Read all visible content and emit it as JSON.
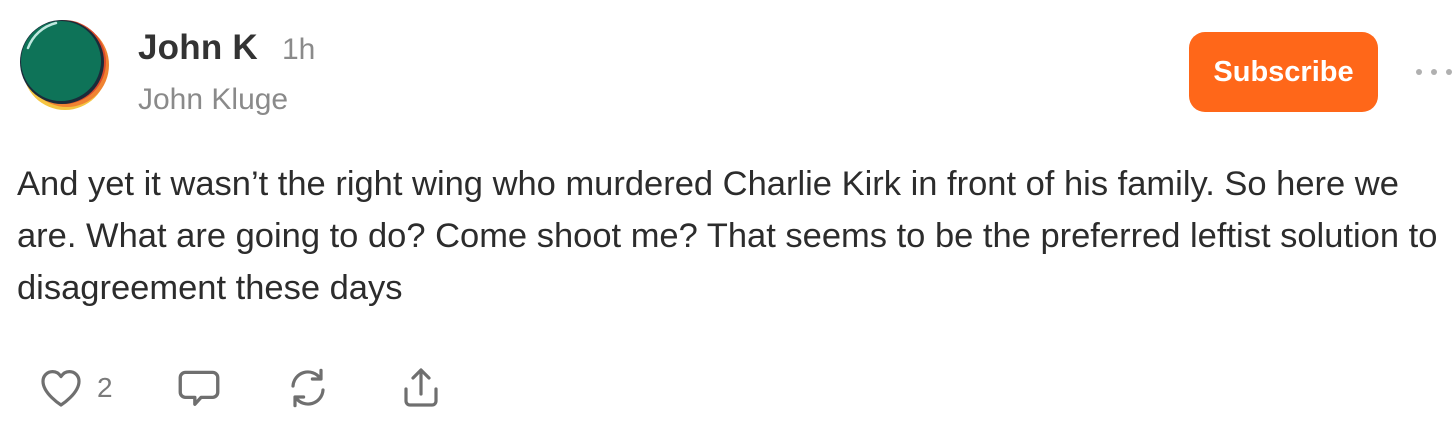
{
  "author": {
    "name": "John K",
    "time": "1h",
    "subtitle": "John Kluge",
    "avatar_colors": {
      "main": "#0e7358",
      "ring_orange": "#f08332",
      "ring_yellow": "#f5c542",
      "ring_red": "#d94a2b",
      "ring_dark": "#1b2b3a",
      "highlight": "#bfe8df"
    }
  },
  "subscribe": {
    "label": "Subscribe",
    "color": "#ff6719"
  },
  "menu": {
    "icon": "more-horizontal-icon"
  },
  "comment": {
    "text": "And yet it wasn’t the right wing who murdered Charlie Kirk in front of his family. So here we are. What are going to do? Come shoot me? That seems to be the preferred leftist solution to disagreement these days"
  },
  "actions": {
    "like": {
      "icon": "heart-icon",
      "count": "2"
    },
    "reply": {
      "icon": "comment-bubble-icon"
    },
    "restack": {
      "icon": "restack-icon"
    },
    "share": {
      "icon": "share-icon"
    }
  }
}
